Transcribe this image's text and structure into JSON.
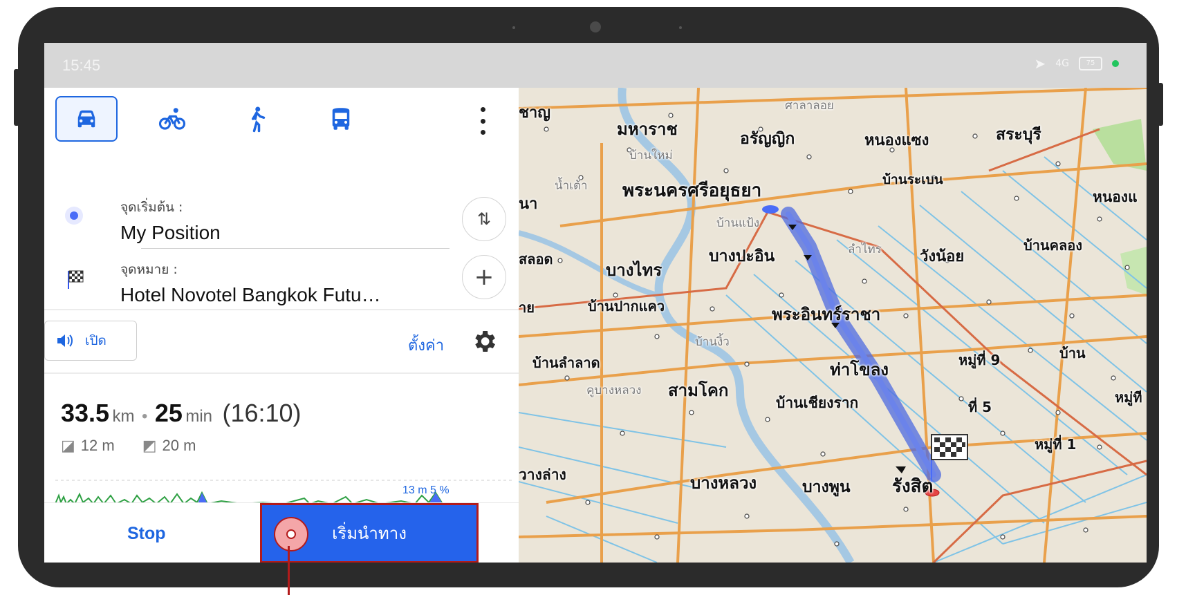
{
  "status_bar": {
    "time": "15:45",
    "network": "4G",
    "battery": "75"
  },
  "modes": [
    {
      "name": "car",
      "active": true
    },
    {
      "name": "bicycle",
      "active": false
    },
    {
      "name": "walk",
      "active": false
    },
    {
      "name": "bus",
      "active": false
    }
  ],
  "route": {
    "start_label": "จุดเริ่มต้น :",
    "start_value": "My Position",
    "dest_label": "จุดหมาย :",
    "dest_value": "Hotel Novotel Bangkok Futu…"
  },
  "voice": {
    "label": "เปิด"
  },
  "settings": {
    "label": "ตั้งค่า"
  },
  "summary": {
    "distance": "33.5",
    "distance_unit": "km",
    "duration": "25",
    "duration_unit": "min",
    "arrival": "(16:10)",
    "ascent": "12 m",
    "descent": "20 m",
    "chart_label": "13 m 5 %"
  },
  "actions": {
    "stop": "Stop",
    "start": "เริ่มนำทาง"
  },
  "map_places": [
    {
      "text": "มหาราช",
      "small": false
    },
    {
      "text": "อรัญญิก",
      "small": false
    },
    {
      "text": "หนองแซง",
      "small": false
    },
    {
      "text": "สระบุรี",
      "small": false
    },
    {
      "text": "ศาลาลอย",
      "small": true
    },
    {
      "text": "บ้านใหม่",
      "small": true
    },
    {
      "text": "บ้านระเบน",
      "small": false
    },
    {
      "text": "พระนครศรีอยุธยา",
      "small": false
    },
    {
      "text": "น้ำเต้า",
      "small": true
    },
    {
      "text": "หนองแ",
      "small": false
    },
    {
      "text": "บ้านแป้ง",
      "small": true
    },
    {
      "text": "บางปะอิน",
      "small": false
    },
    {
      "text": "ลำไทร",
      "small": true
    },
    {
      "text": "วังน้อย",
      "small": false
    },
    {
      "text": "บ้านคลอง",
      "small": false
    },
    {
      "text": "บางไทร",
      "small": false
    },
    {
      "text": "สลอด",
      "small": false
    },
    {
      "text": "บ้านปากแคว",
      "small": false
    },
    {
      "text": "พระอินทร์ราชา",
      "small": false
    },
    {
      "text": "บ้านงิ้ว",
      "small": true
    },
    {
      "text": "บ้านลำลาด",
      "small": false
    },
    {
      "text": "ท่าโขลง",
      "small": false
    },
    {
      "text": "หมู่ที่ 9",
      "small": false
    },
    {
      "text": "บ้าน",
      "small": false
    },
    {
      "text": "คูบางหลวง",
      "small": true
    },
    {
      "text": "สามโคก",
      "small": false
    },
    {
      "text": "บ้านเชียงราก",
      "small": false
    },
    {
      "text": "ที่ 5",
      "small": false
    },
    {
      "text": "หมู่ที",
      "small": false
    },
    {
      "text": "หมู่ที่ 1",
      "small": false
    },
    {
      "text": "วางล่าง",
      "small": false
    },
    {
      "text": "บางหลวง",
      "small": false
    },
    {
      "text": "บางพูน",
      "small": false
    },
    {
      "text": "รังสิต",
      "small": false
    },
    {
      "text": "ชาญ",
      "small": false
    },
    {
      "text": "นา",
      "small": false
    },
    {
      "text": "าย",
      "small": false
    }
  ]
}
